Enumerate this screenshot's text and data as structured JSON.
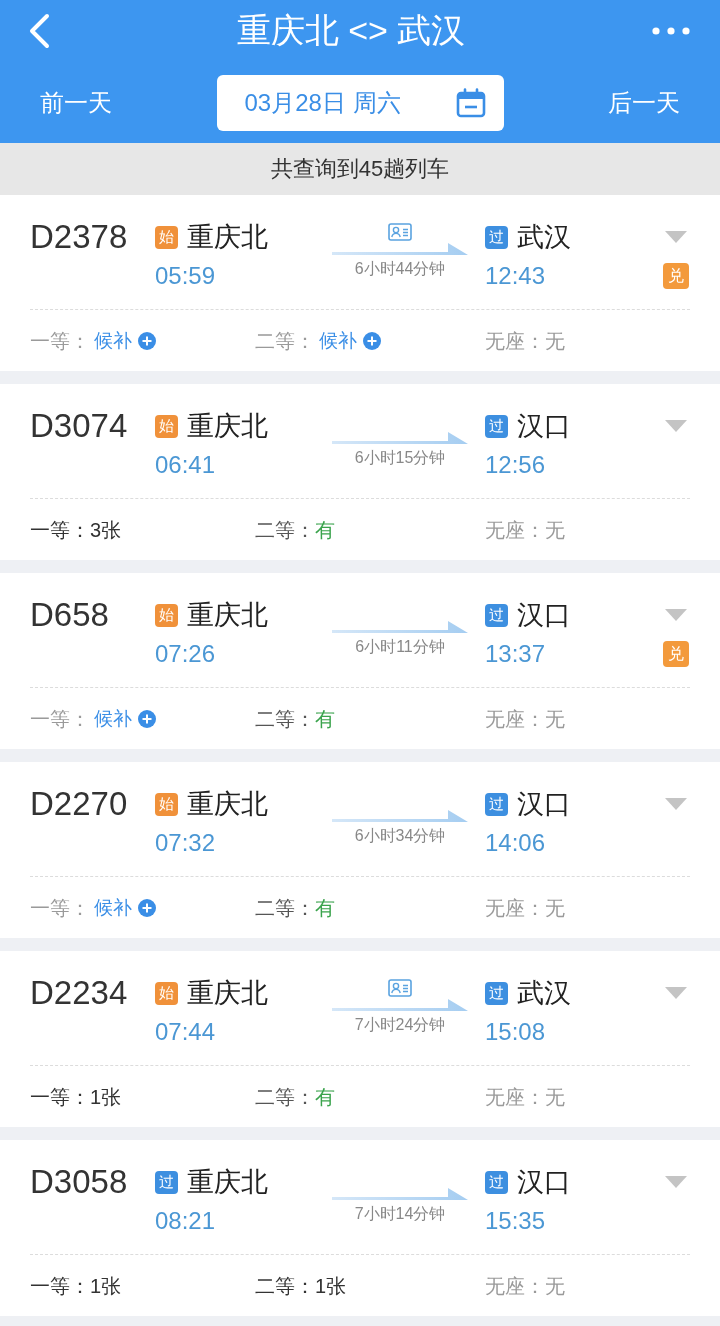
{
  "header": {
    "title": "重庆北 <> 武汉"
  },
  "date_bar": {
    "prev_day": "前一天",
    "date": "03月28日 周六",
    "next_day": "后一天"
  },
  "result_count": "共查询到45趟列车",
  "trains": [
    {
      "number": "D2378",
      "from": {
        "badge": "始",
        "kind": "origin",
        "station": "重庆北",
        "time": "05:59"
      },
      "id_required": true,
      "duration": "6小时44分钟",
      "to": {
        "badge": "过",
        "kind": "passing",
        "station": "武汉",
        "time": "12:43"
      },
      "exchange_badge": "兑",
      "seats": [
        {
          "label": "一等：",
          "value": "候补",
          "kind": "waitlist"
        },
        {
          "label": "二等：",
          "value": "候补",
          "kind": "waitlist"
        },
        {
          "label": "无座：",
          "value": "无",
          "kind": "none"
        }
      ]
    },
    {
      "number": "D3074",
      "from": {
        "badge": "始",
        "kind": "origin",
        "station": "重庆北",
        "time": "06:41"
      },
      "id_required": false,
      "duration": "6小时15分钟",
      "to": {
        "badge": "过",
        "kind": "passing",
        "station": "汉口",
        "time": "12:56"
      },
      "seats": [
        {
          "label": "一等：",
          "value": "3张",
          "kind": "count"
        },
        {
          "label": "二等：",
          "value": "有",
          "kind": "available"
        },
        {
          "label": "无座：",
          "value": "无",
          "kind": "none"
        }
      ]
    },
    {
      "number": "D658",
      "from": {
        "badge": "始",
        "kind": "origin",
        "station": "重庆北",
        "time": "07:26"
      },
      "id_required": false,
      "duration": "6小时11分钟",
      "to": {
        "badge": "过",
        "kind": "passing",
        "station": "汉口",
        "time": "13:37"
      },
      "exchange_badge": "兑",
      "seats": [
        {
          "label": "一等：",
          "value": "候补",
          "kind": "waitlist"
        },
        {
          "label": "二等：",
          "value": "有",
          "kind": "available"
        },
        {
          "label": "无座：",
          "value": "无",
          "kind": "none"
        }
      ]
    },
    {
      "number": "D2270",
      "from": {
        "badge": "始",
        "kind": "origin",
        "station": "重庆北",
        "time": "07:32"
      },
      "id_required": false,
      "duration": "6小时34分钟",
      "to": {
        "badge": "过",
        "kind": "passing",
        "station": "汉口",
        "time": "14:06"
      },
      "seats": [
        {
          "label": "一等：",
          "value": "候补",
          "kind": "waitlist"
        },
        {
          "label": "二等：",
          "value": "有",
          "kind": "available"
        },
        {
          "label": "无座：",
          "value": "无",
          "kind": "none"
        }
      ]
    },
    {
      "number": "D2234",
      "from": {
        "badge": "始",
        "kind": "origin",
        "station": "重庆北",
        "time": "07:44"
      },
      "id_required": true,
      "duration": "7小时24分钟",
      "to": {
        "badge": "过",
        "kind": "passing",
        "station": "武汉",
        "time": "15:08"
      },
      "seats": [
        {
          "label": "一等：",
          "value": "1张",
          "kind": "count"
        },
        {
          "label": "二等：",
          "value": "有",
          "kind": "available"
        },
        {
          "label": "无座：",
          "value": "无",
          "kind": "none"
        }
      ]
    },
    {
      "number": "D3058",
      "from": {
        "badge": "过",
        "kind": "passing",
        "station": "重庆北",
        "time": "08:21"
      },
      "id_required": false,
      "duration": "7小时14分钟",
      "to": {
        "badge": "过",
        "kind": "passing",
        "station": "汉口",
        "time": "15:35"
      },
      "seats": [
        {
          "label": "一等：",
          "value": "1张",
          "kind": "count"
        },
        {
          "label": "二等：",
          "value": "1张",
          "kind": "count"
        },
        {
          "label": "无座：",
          "value": "无",
          "kind": "none"
        }
      ]
    }
  ]
}
